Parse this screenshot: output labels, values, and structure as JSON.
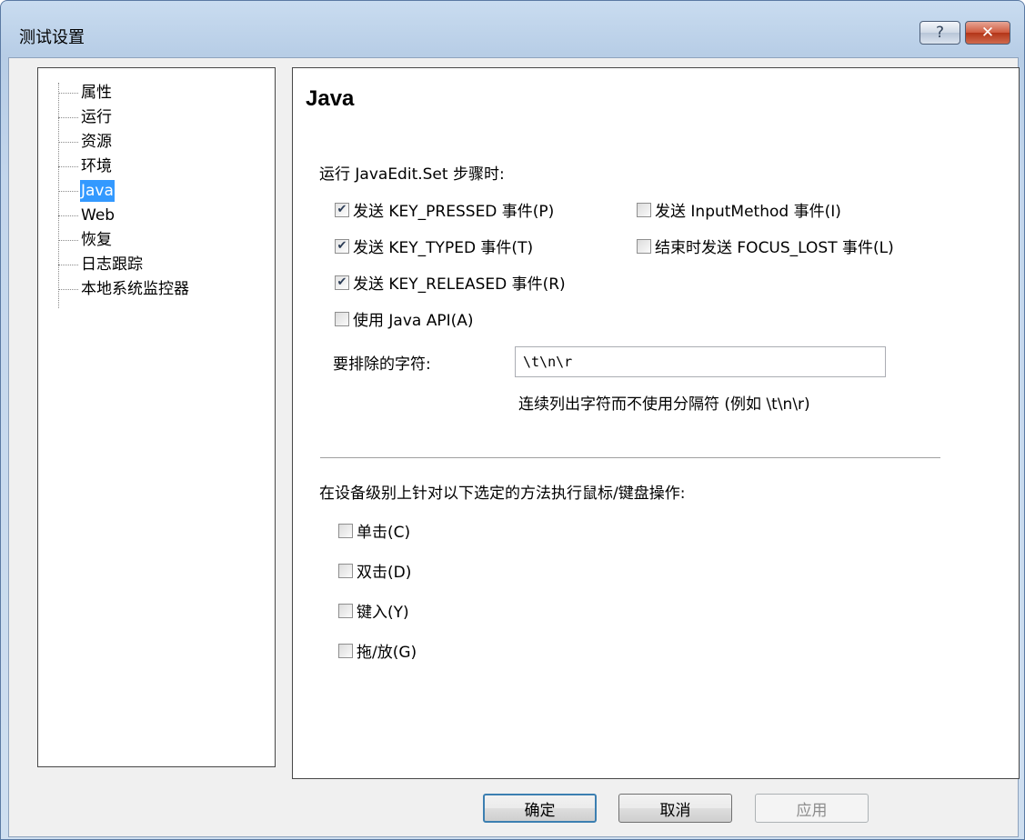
{
  "window": {
    "title": "测试设置",
    "help_label": "?",
    "close_label": "✕"
  },
  "tree": {
    "items": [
      {
        "label": "属性",
        "selected": false
      },
      {
        "label": "运行",
        "selected": false
      },
      {
        "label": "资源",
        "selected": false
      },
      {
        "label": "环境",
        "selected": false
      },
      {
        "label": "Java",
        "selected": true
      },
      {
        "label": "Web",
        "selected": false
      },
      {
        "label": "恢复",
        "selected": false
      },
      {
        "label": "日志跟踪",
        "selected": false
      },
      {
        "label": "本地系统监控器",
        "selected": false
      }
    ]
  },
  "panel": {
    "title": "Java",
    "javaedit_heading": "运行 JavaEdit.Set 步骤时:",
    "checkboxes_left": [
      {
        "label": "发送 KEY_PRESSED 事件(P)",
        "checked": true
      },
      {
        "label": "发送 KEY_TYPED 事件(T)",
        "checked": true
      },
      {
        "label": "发送 KEY_RELEASED 事件(R)",
        "checked": true
      },
      {
        "label": "使用 Java API(A)",
        "checked": false
      }
    ],
    "checkboxes_right": [
      {
        "label": "发送 InputMethod 事件(I)",
        "checked": false
      },
      {
        "label": "结束时发送 FOCUS_LOST 事件(L)",
        "checked": false
      }
    ],
    "exclude_label": "要排除的字符:",
    "exclude_value": "\\t\\n\\r",
    "exclude_hint": "连续列出字符而不使用分隔符 (例如 \\t\\n\\r)",
    "device_heading": "在设备级别上针对以下选定的方法执行鼠标/键盘操作:",
    "device_checkboxes": [
      {
        "label": "单击(C)",
        "checked": false
      },
      {
        "label": "双击(D)",
        "checked": false
      },
      {
        "label": "键入(Y)",
        "checked": false
      },
      {
        "label": "拖/放(G)",
        "checked": false
      }
    ]
  },
  "buttons": {
    "ok": "确定",
    "cancel": "取消",
    "apply": "应用"
  }
}
